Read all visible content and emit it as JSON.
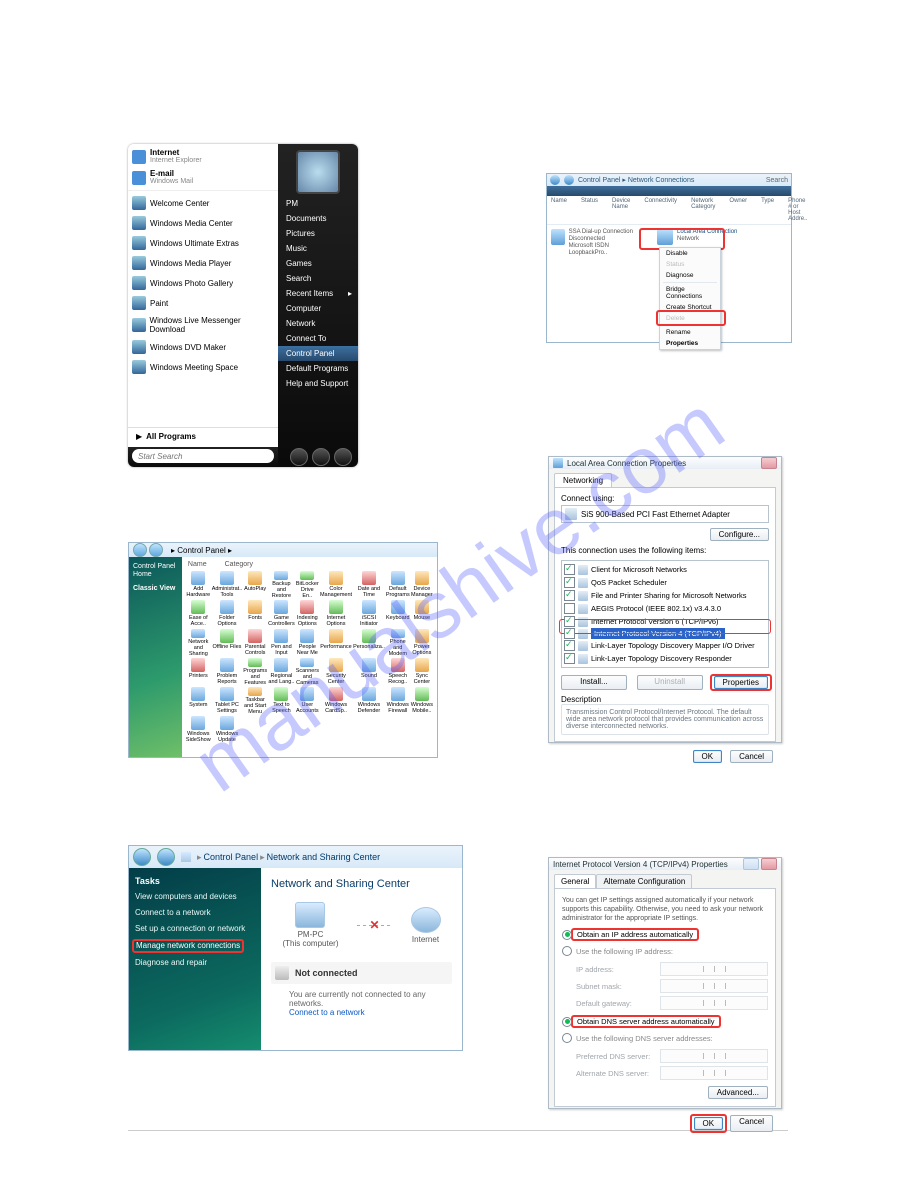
{
  "watermark": "manualshive.com",
  "panel1": {
    "pinned": [
      {
        "title": "Internet",
        "sub": "Internet Explorer"
      },
      {
        "title": "E-mail",
        "sub": "Windows Mail"
      }
    ],
    "apps": [
      "Welcome Center",
      "Windows Media Center",
      "Windows Ultimate Extras",
      "Windows Media Player",
      "Windows Photo Gallery",
      "Paint",
      "Windows Live Messenger Download",
      "Windows DVD Maker",
      "Windows Meeting Space"
    ],
    "all_programs": "All Programs",
    "search_placeholder": "Start Search",
    "right": [
      "PM",
      "Documents",
      "Pictures",
      "Music",
      "Games",
      "Search",
      "Recent Items",
      "Computer",
      "Network",
      "Connect To",
      "Control Panel",
      "Default Programs",
      "Help and Support"
    ],
    "highlight_index": 10
  },
  "panel2": {
    "breadcrumb": "Control Panel",
    "side": [
      "Control Panel Home",
      "Classic View"
    ],
    "columns": [
      "Name",
      "Category"
    ],
    "items": [
      "Add Hardware",
      "Administrat.. Tools",
      "AutoPlay",
      "Backup and Restore",
      "BitLocker Drive En..",
      "Color Management",
      "Date and Time",
      "Default Programs",
      "Device Manager",
      "Ease of Acce..",
      "Folder Options",
      "Fonts",
      "Game Controllers",
      "Indexing Options",
      "Internet Options",
      "iSCSI Initiator",
      "Keyboard",
      "Mouse",
      "Network and Sharing",
      "Offline Files",
      "Parental Controls",
      "Pen and Input",
      "People Near Me",
      "Performance",
      "Personaliza..",
      "Phone and Modem",
      "Power Options",
      "Printers",
      "Problem Reports",
      "Programs and Features",
      "Regional and Lang..",
      "Scanners and Cameras",
      "Security Center",
      "Sound",
      "Speech Recog..",
      "Sync Center",
      "System",
      "Tablet PC Settings",
      "Taskbar and Start Menu",
      "Text to Speech",
      "User Accounts",
      "Windows CardSp..",
      "Windows Defender",
      "Windows Firewall",
      "Windows Mobile..",
      "Windows SideShow",
      "Windows Update"
    ]
  },
  "panel3": {
    "crumb1": "Control Panel",
    "crumb2": "Network and Sharing Center",
    "side_header": "Tasks",
    "side_items": [
      "View computers and devices",
      "Connect to a network",
      "Set up a connection or network",
      "Manage network connections",
      "Diagnose and repair"
    ],
    "highlight_index": 3,
    "title": "Network and Sharing Center",
    "node1": "PM-PC",
    "node1_sub": "(This computer)",
    "node2": "Internet",
    "not_connected": "Not connected",
    "note_line": "You are currently not connected to any networks.",
    "note_link": "Connect to a network"
  },
  "panel4": {
    "crumb": "Control Panel ▸ Network Connections",
    "search_hint": "Search",
    "cols": [
      "Name",
      "Status",
      "Device Name",
      "Connectivity",
      "Network Category",
      "Owner",
      "Type",
      "Phone # or Host Addre.."
    ],
    "item1": {
      "name": "SSA Dial-up Connection",
      "sub1": "Disconnected",
      "sub2": "Microsoft ISDN LoopbackPro.."
    },
    "item2": {
      "name": "Local Area Connection",
      "sub1": "Network",
      "sub2": ""
    },
    "menu": [
      "Disable",
      "Status",
      "Diagnose",
      "Bridge Connections",
      "Create Shortcut",
      "Delete",
      "Rename",
      "Properties"
    ]
  },
  "panel5": {
    "title": "Local Area Connection Properties",
    "tab": "Networking",
    "connect_using_lbl": "Connect using:",
    "adapter": "SiS 900-Based PCI Fast Ethernet Adapter",
    "configure_btn": "Configure...",
    "items_lbl": "This connection uses the following items:",
    "items": [
      {
        "checked": true,
        "label": "Client for Microsoft Networks"
      },
      {
        "checked": true,
        "label": "QoS Packet Scheduler"
      },
      {
        "checked": true,
        "label": "File and Printer Sharing for Microsoft Networks"
      },
      {
        "checked": false,
        "label": "AEGIS Protocol (IEEE 802.1x) v3.4.3.0"
      },
      {
        "checked": true,
        "label": "Internet Protocol Version 6 (TCP/IPv6)"
      },
      {
        "checked": true,
        "label": "Internet Protocol Version 4 (TCP/IPv4)",
        "selected": true
      },
      {
        "checked": true,
        "label": "Link-Layer Topology Discovery Mapper I/O Driver"
      },
      {
        "checked": true,
        "label": "Link-Layer Topology Discovery Responder"
      }
    ],
    "install_btn": "Install...",
    "uninstall_btn": "Uninstall",
    "properties_btn": "Properties",
    "desc_hdr": "Description",
    "desc": "Transmission Control Protocol/Internet Protocol. The default wide area network protocol that provides communication across diverse interconnected networks.",
    "ok": "OK",
    "cancel": "Cancel"
  },
  "panel6": {
    "title": "Internet Protocol Version 4 (TCP/IPv4) Properties",
    "tabs": [
      "General",
      "Alternate Configuration"
    ],
    "note": "You can get IP settings assigned automatically if your network supports this capability. Otherwise, you need to ask your network administrator for the appropriate IP settings.",
    "r1": "Obtain an IP address automatically",
    "r2": "Use the following IP address:",
    "f1": "IP address:",
    "f2": "Subnet mask:",
    "f3": "Default gateway:",
    "r3": "Obtain DNS server address automatically",
    "r4": "Use the following DNS server addresses:",
    "f4": "Preferred DNS server:",
    "f5": "Alternate DNS server:",
    "adv": "Advanced...",
    "ok": "OK",
    "cancel": "Cancel"
  }
}
